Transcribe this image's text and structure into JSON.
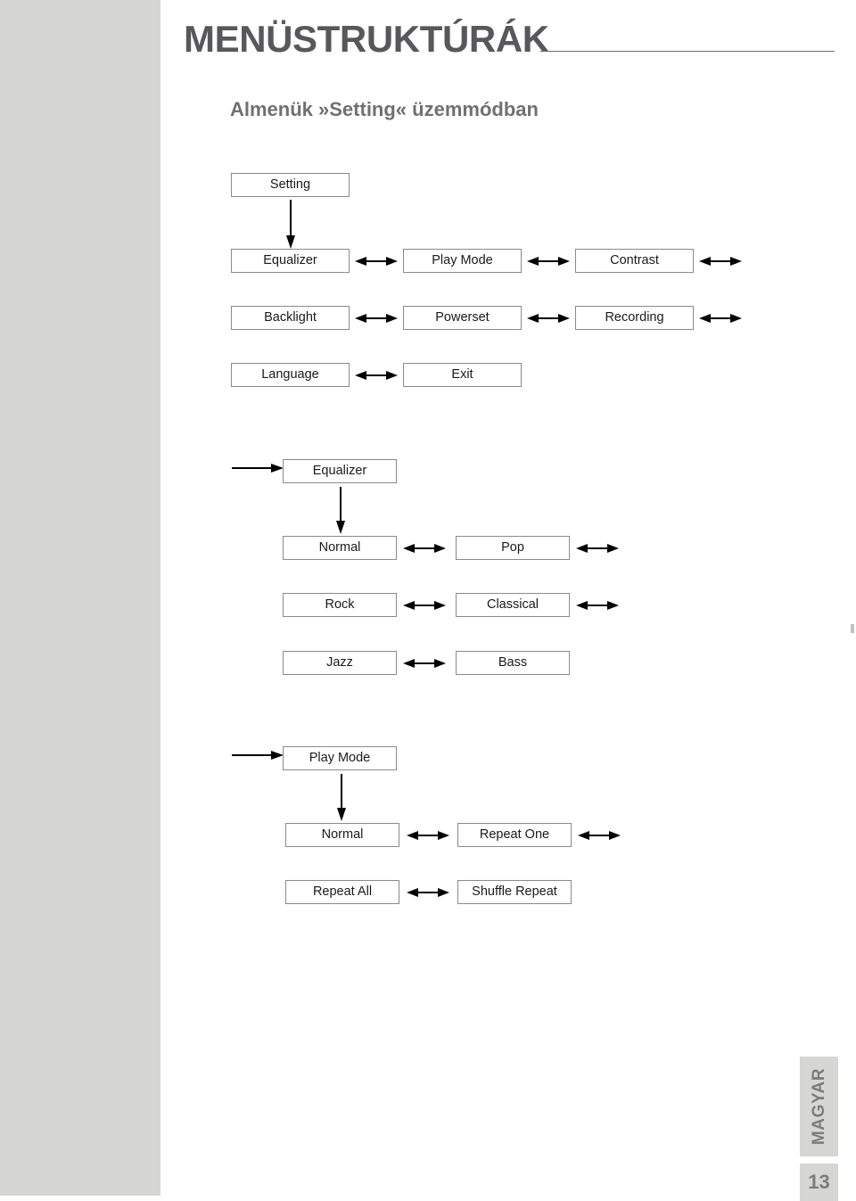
{
  "document": {
    "title": "MENÜSTRUKTÚRÁK",
    "subtitle": "Almenük »Setting« üzemmódban",
    "language_tab": "MAGYAR",
    "page_number": "13"
  },
  "colors": {
    "sidebar": "#d6d6d4",
    "title_text": "#58585a",
    "subtitle_text": "#6f7072",
    "node_border": "#8a8a8a",
    "node_text": "#1a1a1a",
    "arrow": "#000000",
    "footer_text": "#7c7c7e"
  },
  "diagrams": [
    {
      "id": "setting-menu",
      "root": "Setting",
      "rows": [
        [
          "Equalizer",
          "Play Mode",
          "Contrast"
        ],
        [
          "Backlight",
          "Powerset",
          "Recording"
        ],
        [
          "Language",
          "Exit"
        ]
      ]
    },
    {
      "id": "equalizer-menu",
      "root": "Equalizer",
      "rows": [
        [
          "Normal",
          "Pop"
        ],
        [
          "Rock",
          "Classical"
        ],
        [
          "Jazz",
          "Bass"
        ]
      ]
    },
    {
      "id": "play-mode-menu",
      "root": "Play Mode",
      "rows": [
        [
          "Normal",
          "Repeat One"
        ],
        [
          "Repeat All",
          "Shuffle Repeat"
        ]
      ]
    }
  ],
  "nodes": {
    "setting": "Setting",
    "equalizer": "Equalizer",
    "play_mode": "Play Mode",
    "contrast": "Contrast",
    "backlight": "Backlight",
    "powerset": "Powerset",
    "recording": "Recording",
    "language": "Language",
    "exit": "Exit",
    "eq_root": "Equalizer",
    "eq_normal": "Normal",
    "eq_pop": "Pop",
    "eq_rock": "Rock",
    "eq_classical": "Classical",
    "eq_jazz": "Jazz",
    "eq_bass": "Bass",
    "pm_root": "Play Mode",
    "pm_normal": "Normal",
    "pm_repeat_one": "Repeat One",
    "pm_repeat_all": "Repeat All",
    "pm_shuffle_repeat": "Shuffle Repeat"
  }
}
